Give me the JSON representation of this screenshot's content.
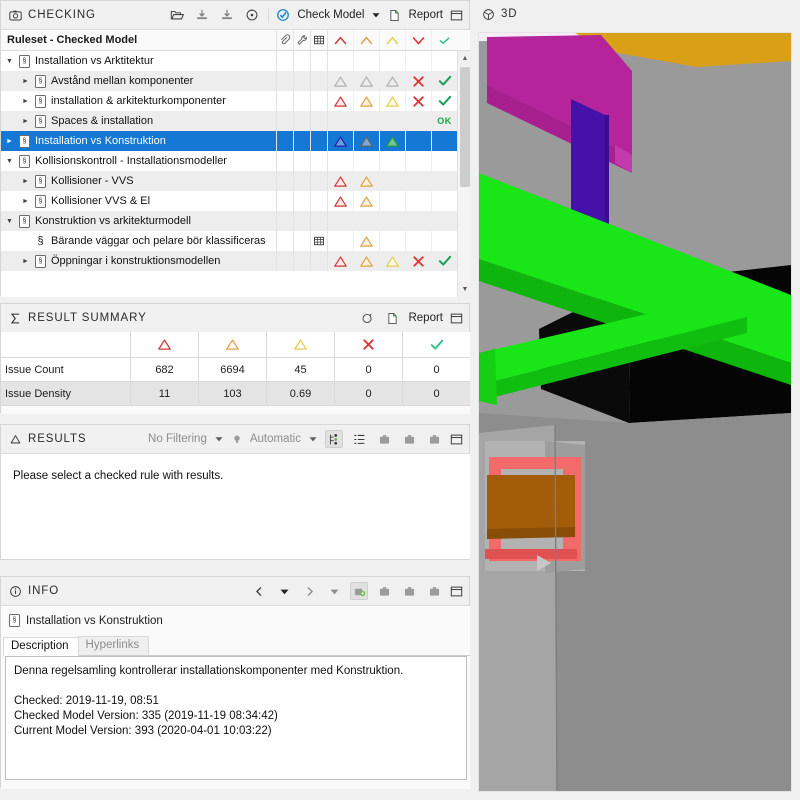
{
  "checking": {
    "title": "CHECKING",
    "title_icon": "camera-icon",
    "tools": [
      {
        "name": "open-folder-icon",
        "label": ""
      },
      {
        "name": "import-icon",
        "label": ""
      },
      {
        "name": "export-icon",
        "label": ""
      },
      {
        "name": "clear-results-icon",
        "label": ""
      }
    ],
    "check_model_label": "Check Model",
    "report_label": "Report",
    "ruleset_header": "Ruleset - Checked Model",
    "column_icons": [
      "attachment-icon",
      "tool-icon",
      "table-icon",
      "severity-critical-icon",
      "severity-major-icon",
      "severity-minor-icon",
      "fail-icon",
      "pass-icon"
    ],
    "rows": [
      {
        "label": "Installation vs Arktitektur",
        "depth": 0,
        "expander": "down",
        "icon": "ruleset-icon",
        "zebra": "light",
        "selected": false,
        "marks": []
      },
      {
        "label": "Avstånd mellan komponenter",
        "depth": 1,
        "expander": "right",
        "icon": "ruleset-icon",
        "zebra": "dark",
        "selected": false,
        "marks": [
          "tri-grey",
          "tri-grey",
          "tri-grey",
          "x-red",
          "check-green"
        ]
      },
      {
        "label": "installation & arkitekturkomponenter",
        "depth": 1,
        "expander": "right",
        "icon": "ruleset-icon",
        "zebra": "light",
        "selected": false,
        "marks": [
          "tri-red",
          "tri-orange",
          "tri-yellow",
          "x-red",
          "check-green"
        ]
      },
      {
        "label": "Spaces & installation",
        "depth": 1,
        "expander": "right",
        "icon": "ruleset-icon",
        "zebra": "dark",
        "selected": false,
        "marks": [
          "",
          "",
          "",
          "",
          "ok-text"
        ]
      },
      {
        "label": "Installation vs Konstruktion",
        "depth": 0,
        "expander": "right",
        "icon": "ruleset-icon",
        "zebra": "light",
        "selected": true,
        "marks": [
          "tri-sel-blue",
          "tri-sel-grey",
          "tri-sel-green"
        ]
      },
      {
        "label": "Kollisionskontroll - Installationsmodeller",
        "depth": 0,
        "expander": "down",
        "icon": "ruleset-icon",
        "zebra": "light",
        "selected": false,
        "marks": []
      },
      {
        "label": "Kollisioner - VVS",
        "depth": 1,
        "expander": "right",
        "icon": "ruleset-icon",
        "zebra": "dark",
        "selected": false,
        "marks": [
          "tri-red",
          "tri-orange"
        ]
      },
      {
        "label": "Kollisioner VVS & El",
        "depth": 1,
        "expander": "right",
        "icon": "ruleset-icon",
        "zebra": "light",
        "selected": false,
        "marks": [
          "tri-red",
          "tri-orange"
        ]
      },
      {
        "label": "Konstruktion vs arkitekturmodell",
        "depth": 0,
        "expander": "down",
        "icon": "ruleset-icon",
        "zebra": "dark",
        "selected": false,
        "marks": []
      },
      {
        "label": "Bärande väggar och pelare  bör klassificeras",
        "depth": 1,
        "expander": "none",
        "icon": "section-icon",
        "zebra": "light",
        "selected": false,
        "marks": [
          "",
          "tri-orange"
        ],
        "table_flag": true
      },
      {
        "label": "Öppningar i konstruktionsmodellen",
        "depth": 1,
        "expander": "right",
        "icon": "ruleset-icon",
        "zebra": "dark",
        "selected": false,
        "marks": [
          "tri-red",
          "tri-orange",
          "tri-yellow",
          "x-red",
          "check-green"
        ]
      }
    ]
  },
  "result_summary": {
    "title": "RESULT SUMMARY",
    "title_icon": "sigma-icon",
    "report_label": "Report",
    "columns": [
      "",
      "severity-critical",
      "severity-major",
      "severity-minor",
      "fail",
      "pass"
    ],
    "rows": [
      {
        "label": "Issue Count",
        "values": [
          "682",
          "6694",
          "45",
          "0",
          "0"
        ]
      },
      {
        "label": "Issue Density",
        "values": [
          "11",
          "103",
          "0.69",
          "0",
          "0"
        ]
      }
    ]
  },
  "results": {
    "title": "RESULTS",
    "title_icon": "triangle-icon",
    "filter_label": "No Filtering",
    "grouping_label": "Automatic",
    "message": "Please select a checked rule with results."
  },
  "info": {
    "title": "INFO",
    "title_icon": "info-icon",
    "rule_name": "Installation vs Konstruktion",
    "tabs": [
      {
        "label": "Description",
        "active": true
      },
      {
        "label": "Hyperlinks",
        "active": false
      }
    ],
    "description": "Denna regelsamling kontrollerar installationskomponenter med Konstruktion.\n\nChecked: 2019-11-19, 08:51\nChecked Model Version: 335 (2019-11-19 08:34:42)\nCurrent Model Version: 393 (2020-04-01 10:03:22)"
  },
  "viewport3d": {
    "title": "3D",
    "title_icon": "cube-icon"
  },
  "colors": {
    "selection_blue": "#1478d4",
    "critical_red": "#cf3a3a",
    "major_orange": "#e8a33d",
    "minor_yellow": "#edd84a",
    "fail_red": "#e03131",
    "pass_green": "#19a05a",
    "magenta": "#b5249a",
    "gold": "#d9a017",
    "purple": "#4611a8",
    "green": "#18e617",
    "black": "#050505",
    "salmon": "#f26a6a",
    "brown": "#a35c09",
    "wall_grey": "#9a9a9a"
  }
}
